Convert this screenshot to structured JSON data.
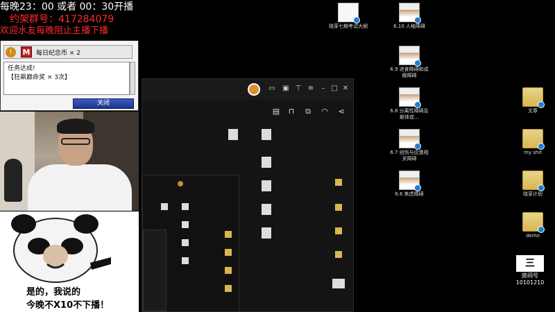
{
  "overlay": {
    "line1": "每晚23：00 或者 00：30开播",
    "line2": "约架群号：417284079",
    "line3": "欢迎水友每晚阻止主播下播"
  },
  "game_dialog": {
    "item_label": "每日纪念币 × 2",
    "message_line1": "任务达成!",
    "message_line2": "【狂飙巅命奖 × 3次】",
    "close_button": "关闭"
  },
  "meme": {
    "caption_line1": "是的，我说的",
    "caption_line2": "今晚不X10不下播！"
  },
  "desktop": {
    "icons_col1": [
      {
        "label": "晓芽七期考试大纲",
        "kind": "doc"
      }
    ],
    "icons_col2": [
      {
        "label": "6.10 人格障碍",
        "kind": "slide"
      },
      {
        "label": "6.9 进食障碍和成瘾障碍",
        "kind": "slide"
      },
      {
        "label": "6.8 分离性障碍及躯体症...",
        "kind": "slide"
      },
      {
        "label": "6.7 创伤与应激相关障碍",
        "kind": "slide"
      },
      {
        "label": "6.6 焦虑障碍",
        "kind": "slide"
      }
    ],
    "icons_col3": [
      {
        "label": "文章",
        "kind": "folder"
      },
      {
        "label": "my shit",
        "kind": "folder"
      },
      {
        "label": "晓芽计划",
        "kind": "folder"
      },
      {
        "label": "demo",
        "kind": "folder"
      }
    ],
    "room_badge": {
      "label": "房间号",
      "number": "10101210"
    }
  }
}
